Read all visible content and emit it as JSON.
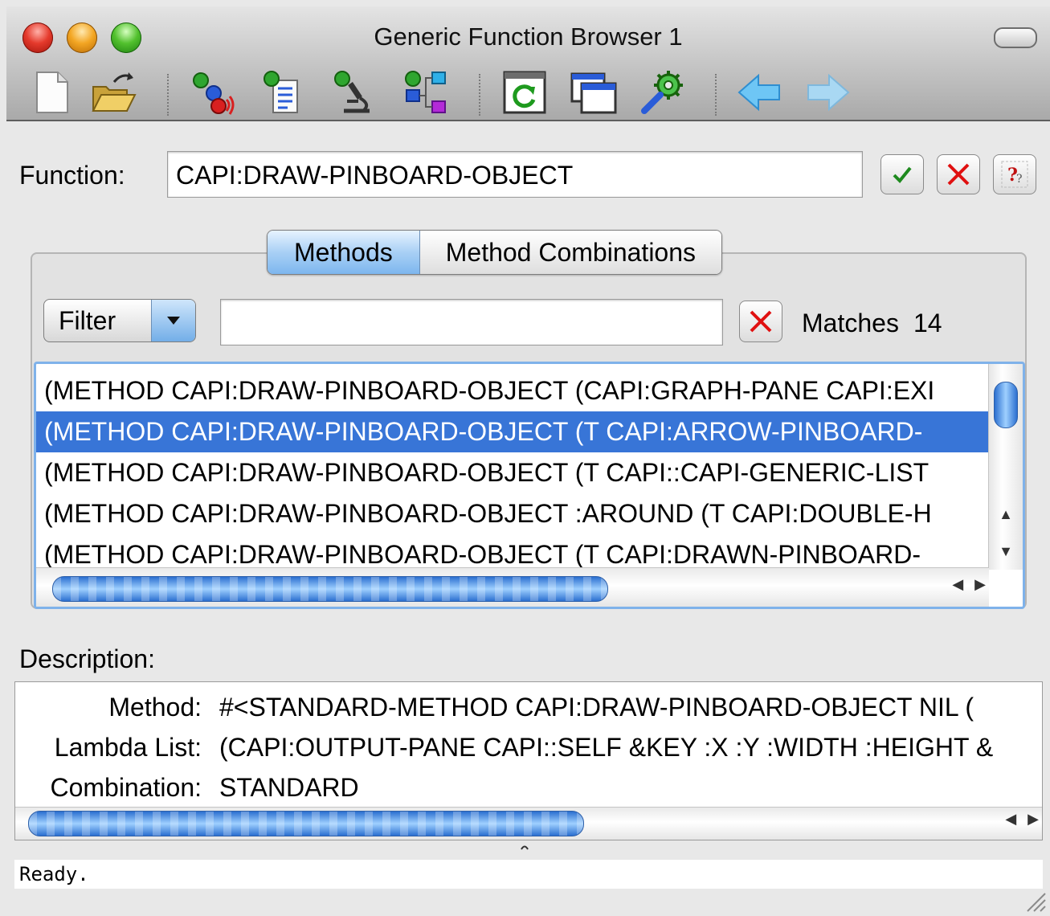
{
  "window": {
    "title": "Generic Function Browser 1"
  },
  "toolbar": {
    "icons": [
      "new-file-icon",
      "open-folder-icon",
      "generic-function-icon",
      "method-list-icon",
      "inspect-microscope-icon",
      "class-hierarchy-icon",
      "refresh-icon",
      "window-icon",
      "preferences-gear-icon",
      "back-arrow-icon",
      "forward-arrow-icon"
    ]
  },
  "function": {
    "label": "Function:",
    "value": "CAPI:DRAW-PINBOARD-OBJECT"
  },
  "tabs": {
    "methods": "Methods",
    "combinations": "Method Combinations",
    "active": "Methods"
  },
  "filter": {
    "button_label": "Filter",
    "input_value": "",
    "matches_label": "Matches",
    "matches_count": "14"
  },
  "methods": {
    "rows": [
      "(METHOD CAPI:DRAW-PINBOARD-OBJECT (CAPI:GRAPH-PANE CAPI:EXI",
      "(METHOD CAPI:DRAW-PINBOARD-OBJECT (T CAPI:ARROW-PINBOARD-",
      "(METHOD CAPI:DRAW-PINBOARD-OBJECT (T CAPI::CAPI-GENERIC-LIST",
      "(METHOD CAPI:DRAW-PINBOARD-OBJECT :AROUND (T CAPI:DOUBLE-H",
      "(METHOD CAPI:DRAW-PINBOARD-OBJECT (T CAPI:DRAWN-PINBOARD-"
    ],
    "selected_index": 1
  },
  "description": {
    "label": "Description:",
    "fields": [
      {
        "key": "Method:",
        "value": "#<STANDARD-METHOD CAPI:DRAW-PINBOARD-OBJECT NIL ("
      },
      {
        "key": "Lambda List:",
        "value": "(CAPI:OUTPUT-PANE CAPI::SELF &KEY :X :Y :WIDTH :HEIGHT &"
      },
      {
        "key": "Combination:",
        "value": "STANDARD"
      }
    ]
  },
  "status": {
    "text": "Ready."
  },
  "colors": {
    "selection": "#3875d7",
    "accent_blue": "#7fb2ea",
    "check_green": "#1e8a1e",
    "cancel_red": "#e01010"
  }
}
